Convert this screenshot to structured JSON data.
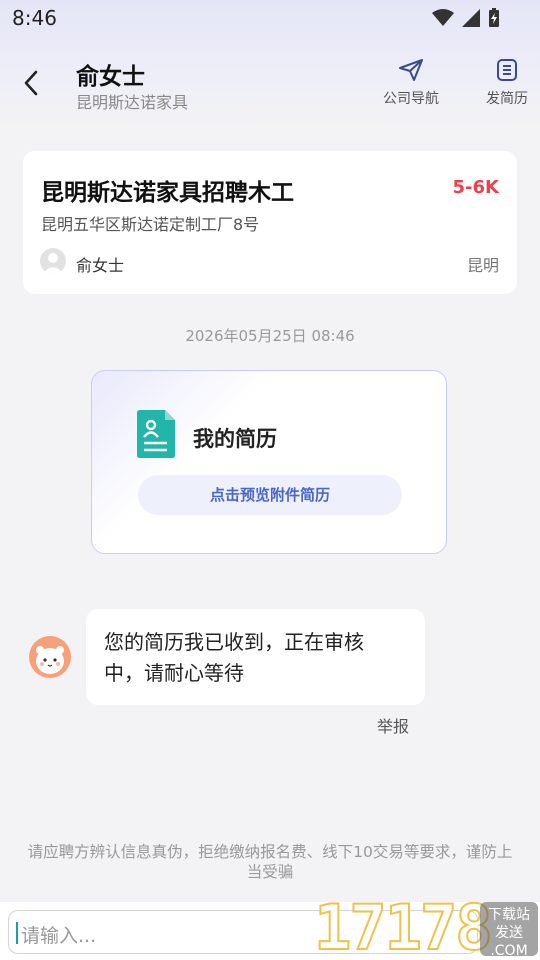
{
  "status_bar": {
    "time": "8:46"
  },
  "header": {
    "contact_name": "俞女士",
    "company": "昆明斯达诺家具",
    "actions": [
      {
        "label": "公司导航",
        "icon": "send-icon"
      },
      {
        "label": "发简历",
        "icon": "document-icon"
      }
    ]
  },
  "job_card": {
    "title": "昆明斯达诺家具招聘木工",
    "salary": "5-6K",
    "address": "昆明五华区斯达诺定制工厂8号",
    "recruiter": "俞女士",
    "city": "昆明"
  },
  "chat": {
    "timestamp": "2026年05月25日 08:46",
    "resume_card": {
      "title": "我的简历",
      "button_label": "点击预览附件简历"
    },
    "messages": [
      {
        "text_line1": "您的简历我已收到，正在审核",
        "text_line2": "中，请耐心等待"
      }
    ],
    "report_label": "举报"
  },
  "warning": {
    "line1": "请应聘方辨认信息真伪，拒绝缴纳报名费、线下10交易等要求，谨防上",
    "line2": "当受骗"
  },
  "input": {
    "placeholder": "请输入..."
  },
  "watermark": {
    "text": "17178",
    "tag_line1": "下载站",
    "tag_line2": "发送",
    "tag_line3": ".COM"
  },
  "colors": {
    "accent": "#4a67c7",
    "salary": "#e8424f",
    "resume_icon": "#22b5a9"
  }
}
